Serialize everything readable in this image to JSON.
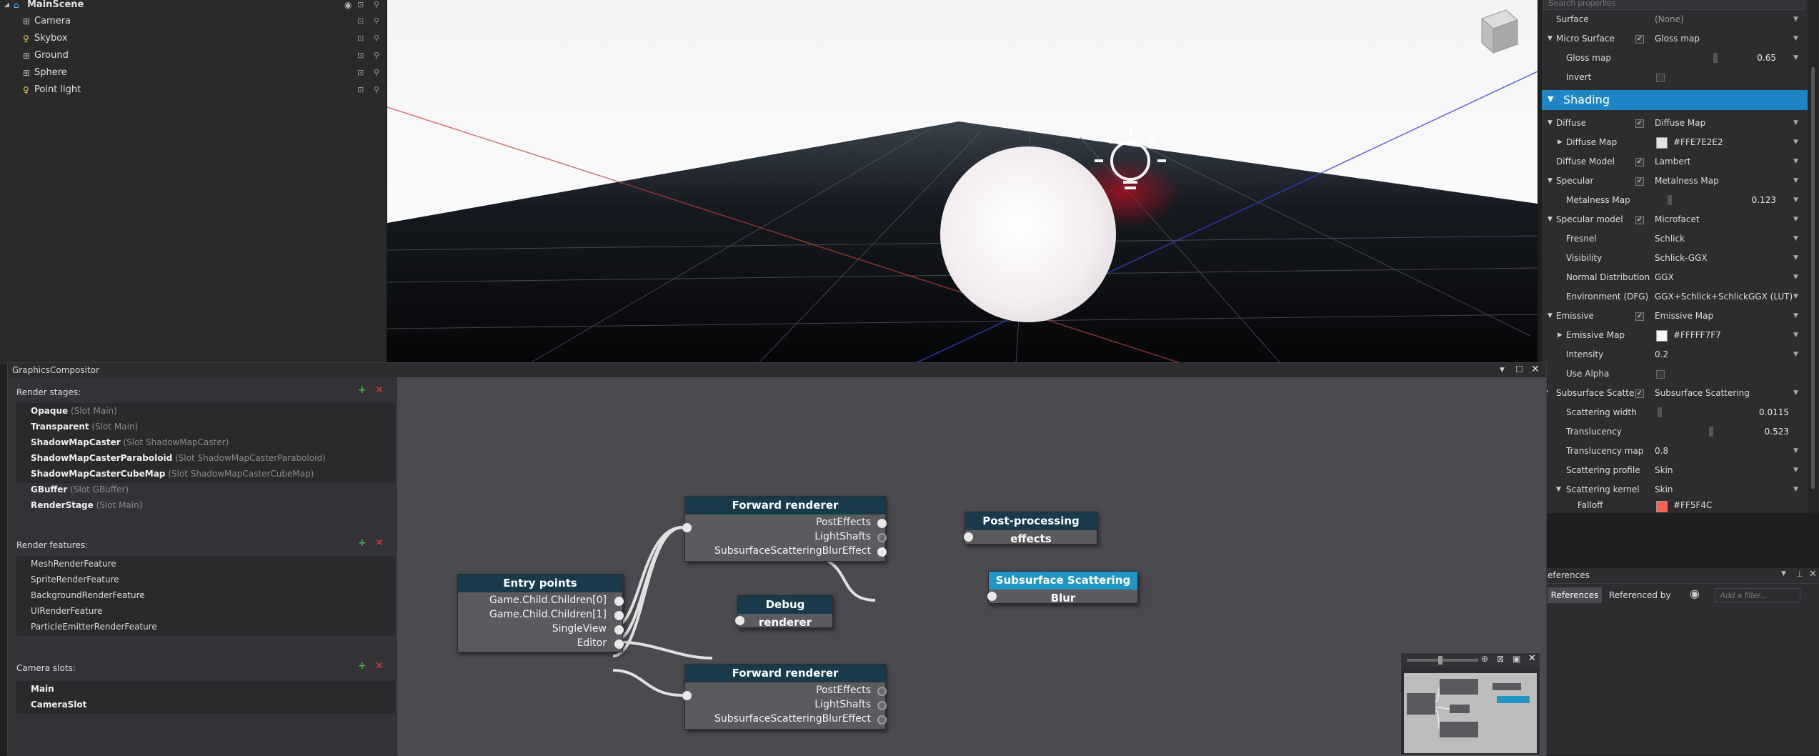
{
  "scene_tree": {
    "root": "MainScene",
    "items": [
      {
        "label": "Camera",
        "icon": "entity-icon"
      },
      {
        "label": "Skybox",
        "icon": "light-icon"
      },
      {
        "label": "Ground",
        "icon": "entity-icon"
      },
      {
        "label": "Sphere",
        "icon": "entity-icon"
      },
      {
        "label": "Point light",
        "icon": "light-icon"
      }
    ]
  },
  "inspector": {
    "search_placeholder": "Search properties",
    "surface": {
      "label": "Surface",
      "value": "(None)"
    },
    "micro_surface": {
      "label": "Micro Surface",
      "value": "Gloss map"
    },
    "gloss_map": {
      "label": "Gloss map",
      "value": "0.65"
    },
    "invert": {
      "label": "Invert"
    },
    "shading_header": "Shading",
    "diffuse": {
      "label": "Diffuse",
      "value": "Diffuse Map"
    },
    "diffuse_map": {
      "label": "Diffuse Map",
      "hex": "#FFE7E2E2",
      "color": "#e7e2e2"
    },
    "diffuse_model": {
      "label": "Diffuse Model",
      "value": "Lambert"
    },
    "specular": {
      "label": "Specular",
      "value": "Metalness Map"
    },
    "metalness_map": {
      "label": "Metalness Map",
      "value": "0.123"
    },
    "specular_model": {
      "label": "Specular model",
      "value": "Microfacet"
    },
    "fresnel": {
      "label": "Fresnel",
      "value": "Schlick"
    },
    "visibility": {
      "label": "Visibility",
      "value": "Schlick-GGX"
    },
    "normal_distribution": {
      "label": "Normal Distribution",
      "value": "GGX"
    },
    "environment": {
      "label": "Environment (DFG)",
      "value": "GGX+Schlick+SchlickGGX (LUT)"
    },
    "emissive": {
      "label": "Emissive",
      "value": "Emissive Map"
    },
    "emissive_map": {
      "label": "Emissive Map",
      "hex": "#FFFFF7F7",
      "color": "#fff7f7"
    },
    "intensity": {
      "label": "Intensity",
      "value": "0.2"
    },
    "use_alpha": {
      "label": "Use Alpha"
    },
    "subsurface": {
      "label": "Subsurface Scatte...",
      "value": "Subsurface Scattering"
    },
    "scattering_width": {
      "label": "Scattering width",
      "value": "0.0115"
    },
    "translucency": {
      "label": "Translucency",
      "value": "0.523"
    },
    "translucency_map": {
      "label": "Translucency map",
      "value": "0.8"
    },
    "scattering_profile": {
      "label": "Scattering profile",
      "value": "Skin"
    },
    "scattering_kernel": {
      "label": "Scattering kernel",
      "value": "Skin"
    },
    "falloff": {
      "label": "Falloff",
      "hex": "#FF5F4C",
      "color": "#ff5f4c"
    }
  },
  "references": {
    "title": "eferences",
    "tab_references": "References",
    "tab_referenced_by": "Referenced by",
    "filter_placeholder": "Add a filter..."
  },
  "graphics_compositor": {
    "title": "GraphicsCompositor",
    "render_stages_label": "Render stages:",
    "render_stages": [
      {
        "name": "Opaque",
        "slot": "(Slot Main)"
      },
      {
        "name": "Transparent",
        "slot": "(Slot Main)"
      },
      {
        "name": "ShadowMapCaster",
        "slot": "(Slot ShadowMapCaster)"
      },
      {
        "name": "ShadowMapCasterParaboloid",
        "slot": "(Slot ShadowMapCasterParaboloid)"
      },
      {
        "name": "ShadowMapCasterCubeMap",
        "slot": "(Slot ShadowMapCasterCubeMap)"
      },
      {
        "name": "GBuffer",
        "slot": "(Slot GBuffer)"
      },
      {
        "name": "RenderStage",
        "slot": "(Slot Main)"
      }
    ],
    "render_features_label": "Render features:",
    "render_features": [
      "MeshRenderFeature",
      "SpriteRenderFeature",
      "BackgroundRenderFeature",
      "UIRenderFeature",
      "ParticleEmitterRenderFeature"
    ],
    "camera_slots_label": "Camera slots:",
    "camera_slots": [
      "Main",
      "CameraSlot"
    ],
    "nodes": {
      "entry": {
        "title": "Entry points",
        "pins": [
          "Game.Child.Children[0]",
          "Game.Child.Children[1]",
          "SingleView",
          "Editor"
        ]
      },
      "forward1": {
        "title": "Forward renderer",
        "pins": [
          "PostEffects",
          "LightShafts",
          "SubsurfaceScatteringBlurEffect"
        ]
      },
      "debug": {
        "title": "Debug renderer"
      },
      "forward2": {
        "title": "Forward renderer",
        "pins": [
          "PostEffects",
          "LightShafts",
          "SubsurfaceScatteringBlurEffect"
        ]
      },
      "post": {
        "title": "Post-processing effects"
      },
      "sss": {
        "title": "Subsurface Scattering Blur"
      }
    }
  }
}
